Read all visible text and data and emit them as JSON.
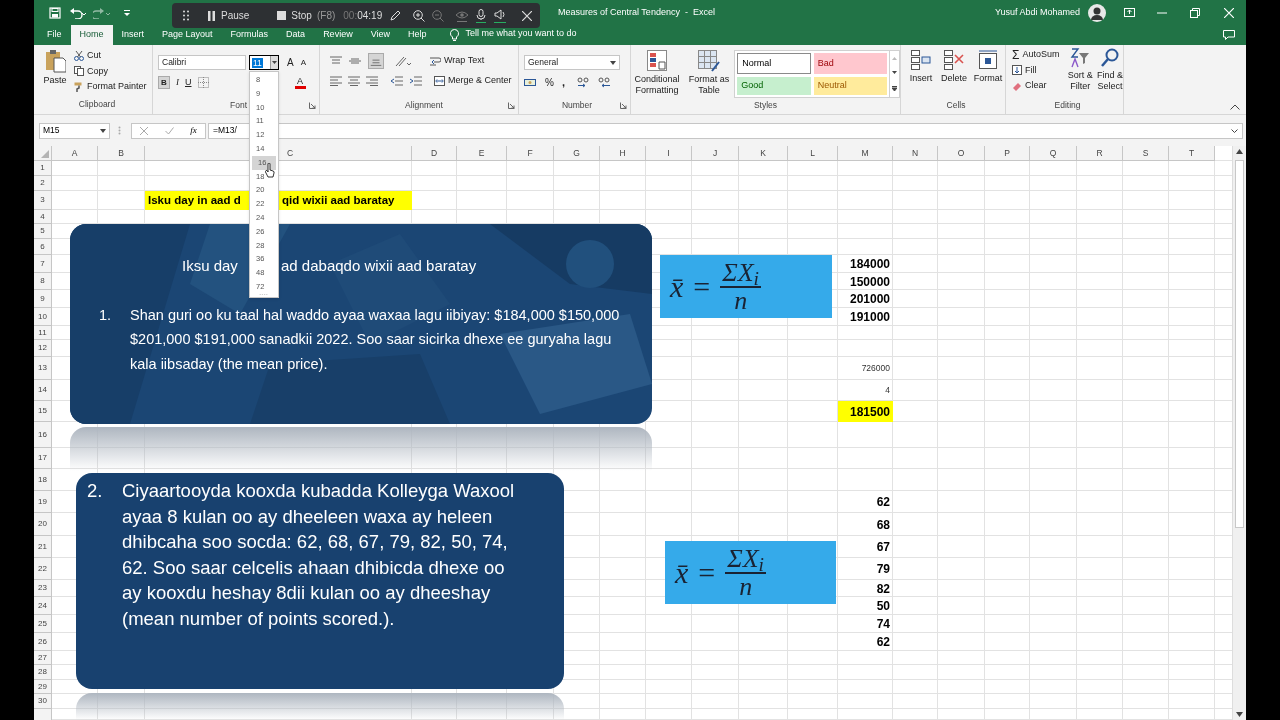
{
  "title_bar": {
    "title": "Measures of Central Tendency  -  Excel",
    "user": "Yusuf Abdi Mohamed"
  },
  "recorder": {
    "pause": "Pause",
    "stop": "Stop",
    "shortcut": "(F8)",
    "timer_dim": "00:",
    "timer": "04:19"
  },
  "tabs": [
    {
      "label": "File",
      "selected": false
    },
    {
      "label": "Home",
      "selected": true
    },
    {
      "label": "Insert",
      "selected": false
    },
    {
      "label": "Page Layout",
      "selected": false
    },
    {
      "label": "Formulas",
      "selected": false
    },
    {
      "label": "Data",
      "selected": false
    },
    {
      "label": "Review",
      "selected": false
    },
    {
      "label": "View",
      "selected": false
    },
    {
      "label": "Help",
      "selected": false
    }
  ],
  "tell_me": "Tell me what you want to do",
  "ribbon": {
    "clipboard": {
      "paste": "Paste",
      "cut": "Cut",
      "copy": "Copy",
      "format_painter": "Format Painter",
      "label": "Clipboard"
    },
    "font": {
      "name": "Calibri",
      "size": "11",
      "grow": "A",
      "shrink": "A",
      "bold": "B",
      "italic": "I",
      "underline": "U",
      "font_color": "A",
      "label": "Font"
    },
    "alignment": {
      "wrap_text": "Wrap Text",
      "merge_center": "Merge & Center",
      "label": "Alignment"
    },
    "number": {
      "format": "General",
      "percent": "%",
      "comma": ",",
      "label": "Number"
    },
    "styles": {
      "conditional_formatting": "Conditional Formatting",
      "format_as_table": "Format as Table",
      "label": "Styles",
      "gallery": [
        {
          "label": "Normal",
          "kind": "normal"
        },
        {
          "label": "Bad",
          "kind": "bad"
        },
        {
          "label": "Good",
          "kind": "good"
        },
        {
          "label": "Neutral",
          "kind": "neutral"
        }
      ]
    },
    "cells": {
      "insert": "Insert",
      "delete": "Delete",
      "format": "Format",
      "label": "Cells"
    },
    "editing": {
      "autosum_glyph": "Σ",
      "autosum": "AutoSum",
      "fill": "Fill",
      "clear": "Clear",
      "sort_filter": "Sort & Filter",
      "find_select": "Find & Select",
      "label": "Editing"
    }
  },
  "formula_bar": {
    "name_box": "M15",
    "fx": "fx",
    "formula": "=M13/"
  },
  "font_size_dropdown": {
    "options": [
      {
        "label": "8",
        "selected": false
      },
      {
        "label": "9",
        "selected": false
      },
      {
        "label": "10",
        "selected": false
      },
      {
        "label": "11",
        "selected": false
      },
      {
        "label": "12",
        "selected": false
      },
      {
        "label": "14",
        "selected": false
      },
      {
        "label": "16",
        "selected": true
      },
      {
        "label": "18",
        "selected": false
      },
      {
        "label": "20",
        "selected": false
      },
      {
        "label": "22",
        "selected": false
      },
      {
        "label": "24",
        "selected": false
      },
      {
        "label": "26",
        "selected": false
      },
      {
        "label": "28",
        "selected": false
      },
      {
        "label": "36",
        "selected": false
      },
      {
        "label": "48",
        "selected": false
      },
      {
        "label": "72",
        "selected": false
      }
    ]
  },
  "sheet": {
    "columns": [
      "A",
      "B",
      "C",
      "D",
      "E",
      "F",
      "G",
      "H",
      "I",
      "J",
      "K",
      "L",
      "M",
      "N",
      "O",
      "P",
      "Q",
      "R",
      "S",
      "T"
    ],
    "rows": [
      "1",
      "2",
      "3",
      "4",
      "5",
      "6",
      "7",
      "8",
      "9",
      "10",
      "11",
      "12",
      "13",
      "14",
      "15",
      "16",
      "17",
      "18",
      "19",
      "20",
      "21",
      "22",
      "23",
      "24",
      "25",
      "26",
      "27",
      "28",
      "29",
      "30"
    ],
    "cells": [
      {
        "parts": [
          "Isku day in aad d",
          "qid wixii aad baratay"
        ],
        "bold": true,
        "highlighted": true
      },
      {
        "text": "184000",
        "bold": true,
        "highlighted": false
      },
      {
        "text": "150000",
        "bold": true,
        "highlighted": false
      },
      {
        "text": "201000",
        "bold": true,
        "highlighted": false
      },
      {
        "text": "191000",
        "bold": true,
        "highlighted": false
      },
      {
        "text": "726000",
        "bold": false,
        "highlighted": false
      },
      {
        "text": "4",
        "bold": false,
        "highlighted": false
      },
      {
        "text": "181500",
        "bold": true,
        "highlighted": true
      },
      {
        "text": "62",
        "bold": true,
        "highlighted": false
      },
      {
        "text": "68",
        "bold": true,
        "highlighted": false
      },
      {
        "text": "67",
        "bold": true,
        "highlighted": false
      },
      {
        "text": "79",
        "bold": true,
        "highlighted": false
      },
      {
        "text": "82",
        "bold": true,
        "highlighted": false
      },
      {
        "text": "50",
        "bold": true,
        "highlighted": false
      },
      {
        "text": "74",
        "bold": true,
        "highlighted": false
      },
      {
        "text": "62",
        "bold": true,
        "highlighted": false
      }
    ]
  },
  "shapes": [
    {
      "title_parts": [
        "Iksu day",
        "ad dabaqdo wixii aad baratay"
      ],
      "number": "1.",
      "text": "Shan guri oo ku taal hal waddo ayaa waxaa lagu iibiyay: $184,000 $150,000 $201,000 $191,000 sanadkii 2022.  Soo saar sicirka dhexe ee guryaha lagu kala iibsaday (the mean price)."
    },
    {
      "number": "2.",
      "text": "Ciyaartooyda kooxda kubadda Kolleyga Waxool ayaa 8 kulan oo ay dheeleen waxa ay heleen dhibcaha soo socda: 62, 68, 67, 79, 82, 50, 74, 62. Soo saar celcelis ahaan dhibicda dhexe oo ay kooxdu heshay 8dii kulan oo ay dheeshay (mean number of points scored.)."
    }
  ],
  "formulas": [
    {
      "variable": "x̄",
      "equals": "=",
      "numerator": "ΣX$_{i}$",
      "denominator": "n"
    },
    {
      "variable": "x̄",
      "equals": "=",
      "numerator": "ΣX$_{i}$",
      "denominator": "n"
    }
  ]
}
